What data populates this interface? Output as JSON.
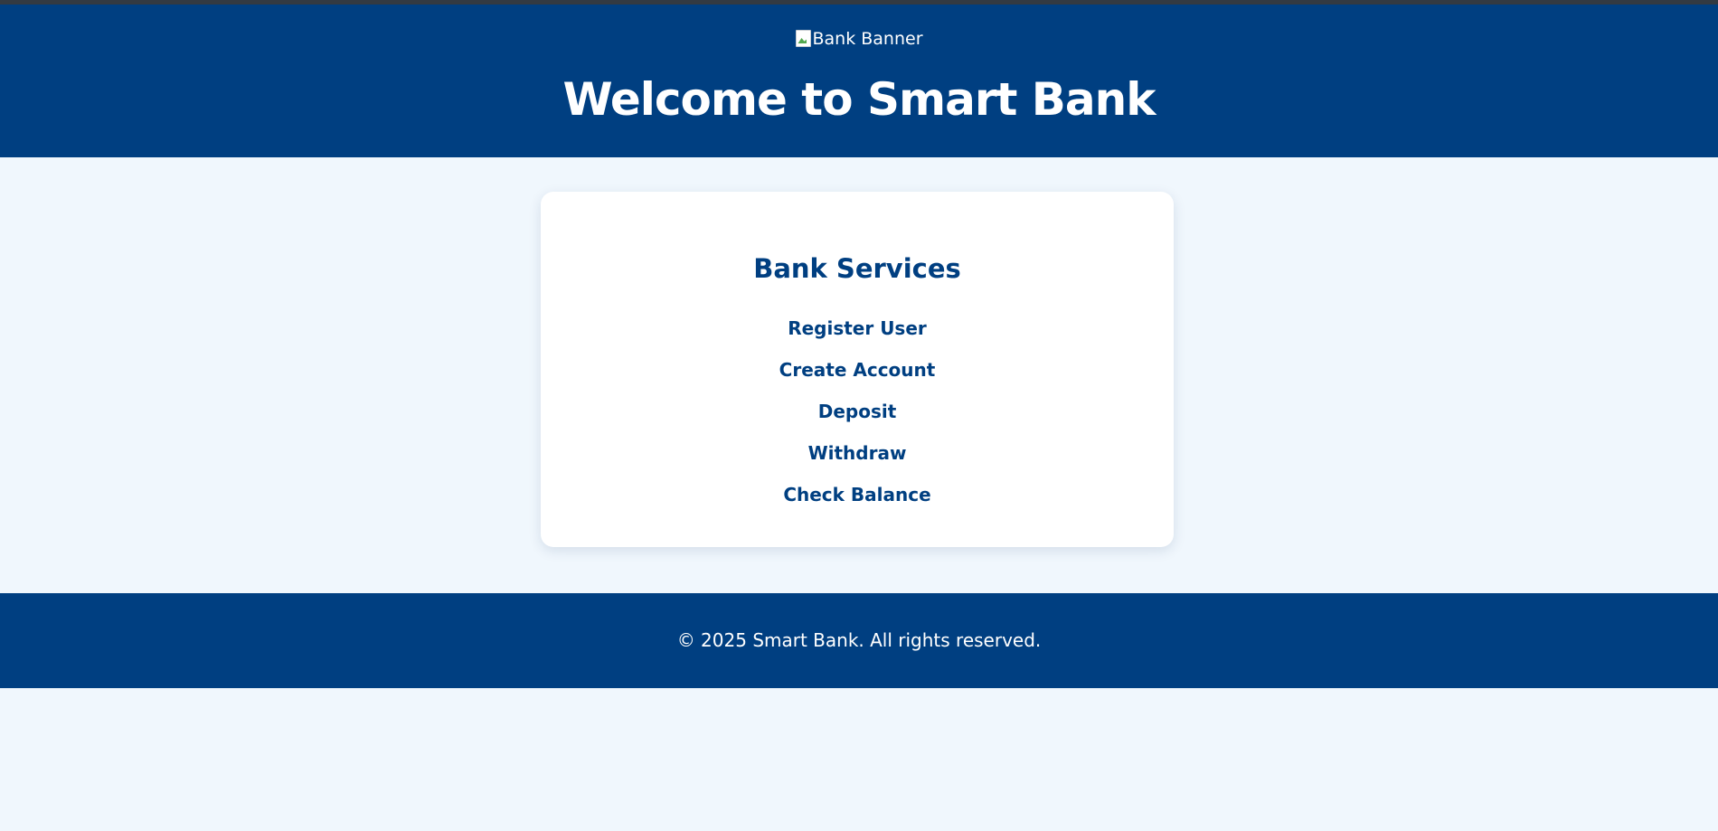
{
  "header": {
    "banner_alt": "Bank Banner",
    "title": "Welcome to Smart Bank"
  },
  "services": {
    "heading": "Bank Services",
    "links": [
      {
        "label": "Register User"
      },
      {
        "label": "Create Account"
      },
      {
        "label": "Deposit"
      },
      {
        "label": "Withdraw"
      },
      {
        "label": "Check Balance"
      }
    ]
  },
  "footer": {
    "text": "© 2025 Smart Bank. All rights reserved."
  },
  "colors": {
    "primary": "#003f81",
    "background": "#f0f7fd",
    "card": "#ffffff"
  }
}
